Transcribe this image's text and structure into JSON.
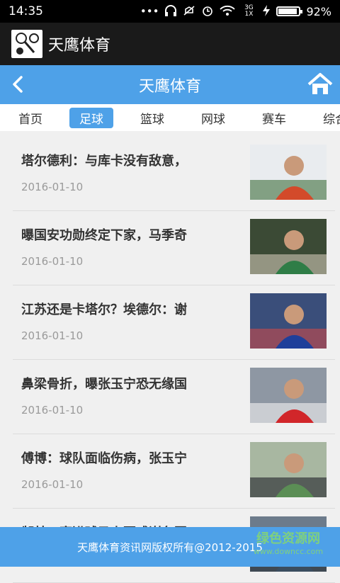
{
  "statusbar": {
    "time": "14:35",
    "signal_label": "3G 1X",
    "battery_percent": "92%",
    "battery_level": 0.92,
    "icons": [
      "more-icon",
      "headset-icon",
      "mute-icon",
      "alarm-icon",
      "wifi-icon",
      "signal-icon",
      "charging-icon",
      "battery-icon"
    ]
  },
  "app": {
    "title": "天鹰体育"
  },
  "navbar": {
    "title": "天鹰体育",
    "back_icon": "chevron-left-icon",
    "home_icon": "home-icon"
  },
  "tabs": [
    {
      "label": "首页",
      "active": false
    },
    {
      "label": "足球",
      "active": true
    },
    {
      "label": "篮球",
      "active": false
    },
    {
      "label": "网球",
      "active": false
    },
    {
      "label": "赛车",
      "active": false
    },
    {
      "label": "综合",
      "active": false
    }
  ],
  "articles": [
    {
      "title": "塔尔德利：与库卡没有敌意，",
      "date": "2016-01-10",
      "thumb_colors": [
        "#e9ecef",
        "#d34a2a",
        "#3d6e3a"
      ]
    },
    {
      "title": "曝国安功勋终定下家，马季奇",
      "date": "2016-01-10",
      "thumb_colors": [
        "#3b4a35",
        "#2f7d47",
        "#d0c8b5"
      ]
    },
    {
      "title": "江苏还是卡塔尔？埃德尔：谢",
      "date": "2016-01-10",
      "thumb_colors": [
        "#3a4e7a",
        "#1f3f9a",
        "#c94a4a"
      ]
    },
    {
      "title": "鼻梁骨折，曝张玉宁恐无缘国",
      "date": "2016-01-10",
      "thumb_colors": [
        "#8e97a3",
        "#d1262a",
        "#f1f1f1"
      ]
    },
    {
      "title": "傅博：球队面临伤病，张玉宁",
      "date": "2016-01-10",
      "thumb_colors": [
        "#a8b7a1",
        "#5b8e55",
        "#20222a"
      ]
    },
    {
      "title": "郜林：赛进球马上要感谢各国",
      "date": "",
      "thumb_colors": [
        "#6c7b8b",
        "#3b4d5f",
        "#22282e"
      ]
    }
  ],
  "footer": {
    "copyright": "天鹰体育资讯网版权所有@2012-2015"
  },
  "watermark": {
    "name": "绿色资源网",
    "url": "www.downcc.com"
  }
}
